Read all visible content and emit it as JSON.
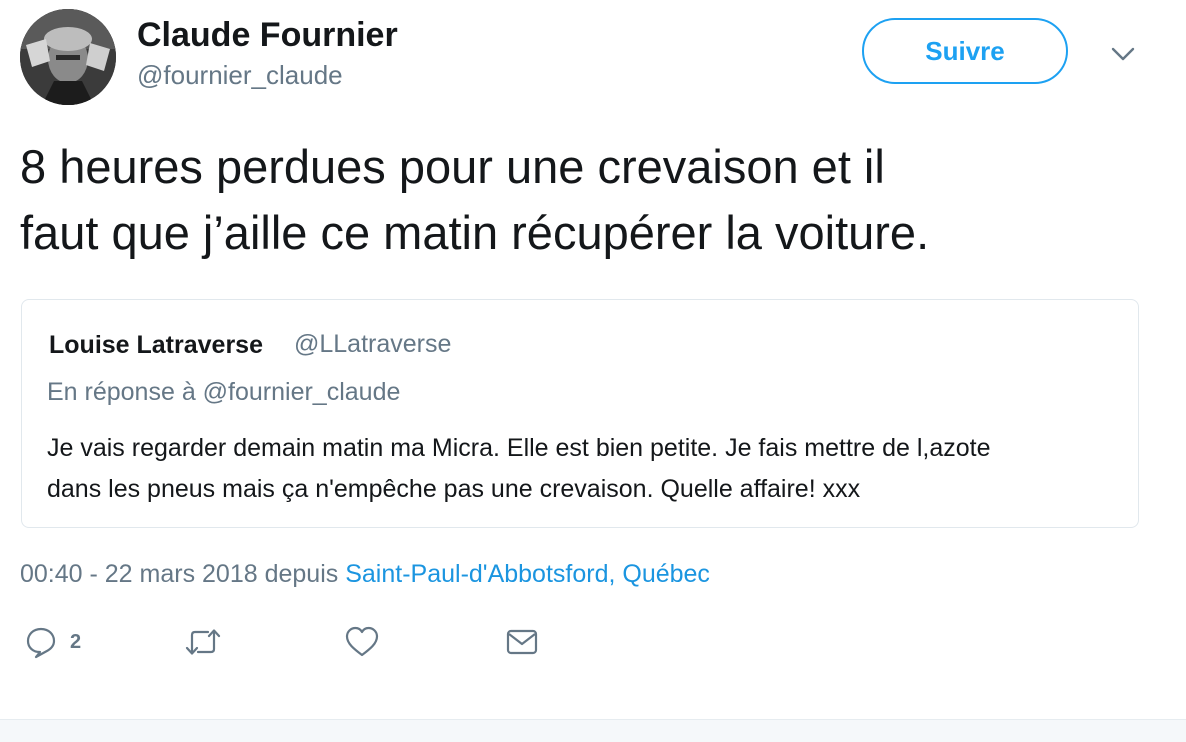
{
  "author": {
    "name": "Claude Fournier",
    "handle": "@fournier_claude"
  },
  "follow_button": {
    "label": "Suivre"
  },
  "tweet": {
    "text_line1": "8 heures perdues pour une crevaison et il",
    "text_line2": "faut que j’aille ce matin récupérer la voiture."
  },
  "quoted": {
    "name": "Louise Latraverse",
    "handle": "@LLatraverse",
    "reply_to": "En réponse à @fournier_claude",
    "text_line1": "Je vais regarder demain matin ma Micra. Elle est bien petite. Je fais mettre de l,azote",
    "text_line2": "dans les pneus mais ça n'empêche pas une crevaison. Quelle affaire! xxx"
  },
  "meta": {
    "timestamp": "00:40 - 22 mars 2018 depuis",
    "location": "Saint-Paul-d'Abbotsford, Québec"
  },
  "actions": {
    "reply_count": "2",
    "icons": [
      "reply-icon",
      "retweet-icon",
      "like-icon",
      "message-icon"
    ]
  },
  "colors": {
    "accent": "#1da1f2",
    "link": "#1b95e0",
    "secondary_text": "#657786",
    "primary_text": "#14171a",
    "border": "#e1e8ed"
  }
}
